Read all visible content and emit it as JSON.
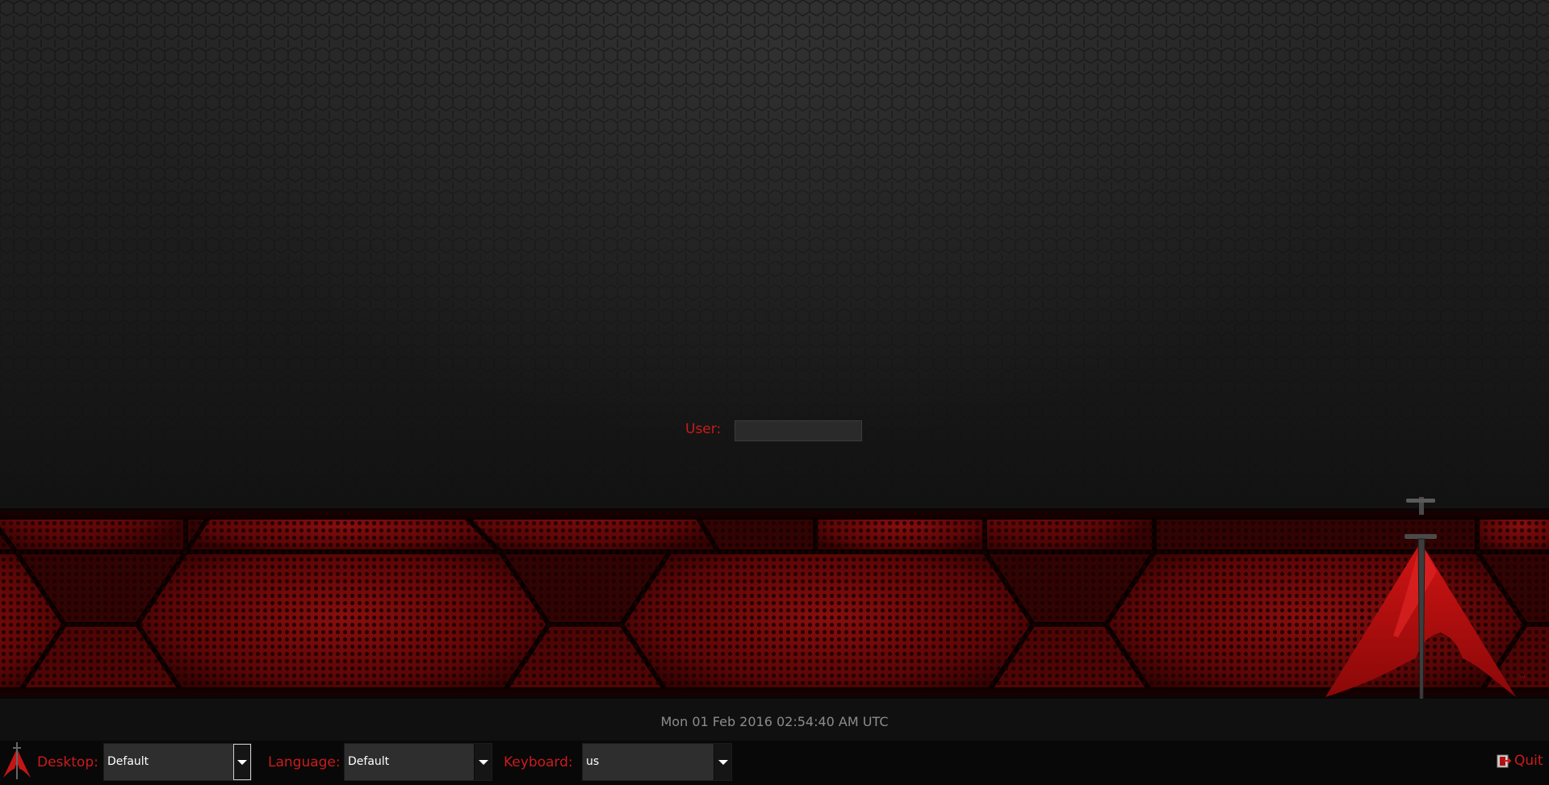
{
  "login": {
    "user_label": "User:",
    "user_value": ""
  },
  "clock": {
    "text": "Mon 01 Feb 2016 02:54:40 AM UTC"
  },
  "taskbar": {
    "desktop_label": "Desktop:",
    "desktop_value": "Default",
    "language_label": "Language:",
    "language_value": "Default",
    "keyboard_label": "Keyboard:",
    "keyboard_value": "us",
    "quit_label": "Quit"
  },
  "branding": {
    "logo_icon": "blackarch-logo-icon",
    "trademark": "™"
  },
  "colors": {
    "accent_red": "#cc1b1b",
    "band_red": "#7a0a0a",
    "background": "#1a1a1a",
    "clock_text": "#8c8c8c"
  }
}
